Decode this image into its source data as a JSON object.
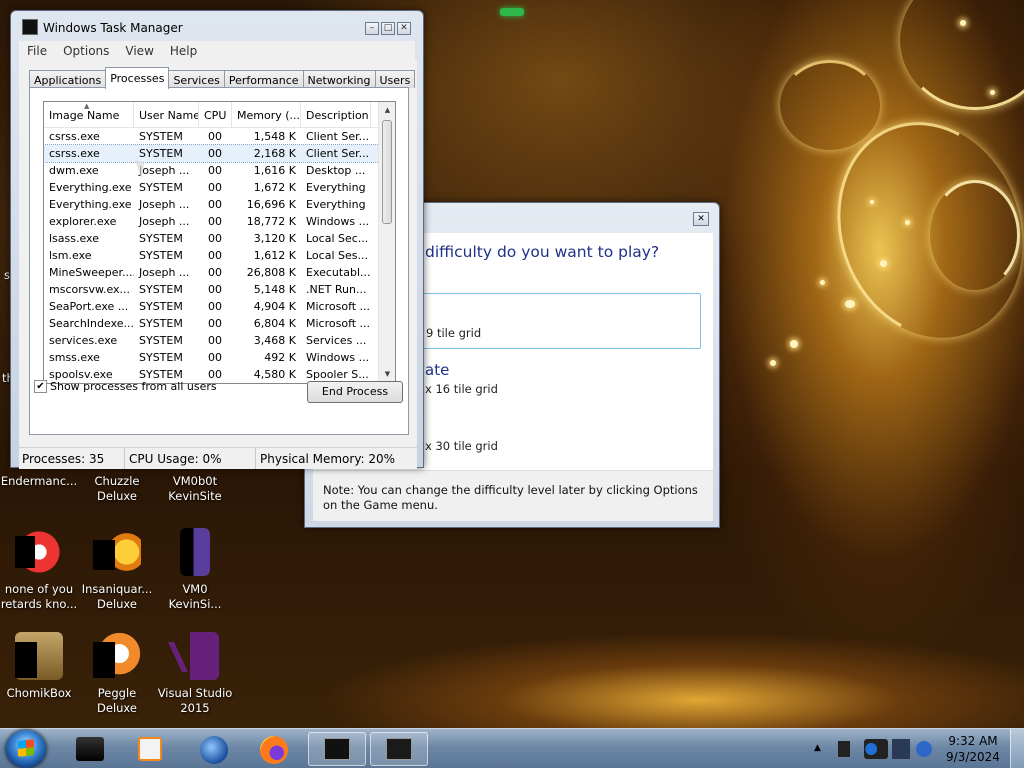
{
  "task_manager": {
    "title": "Windows Task Manager",
    "menu": [
      "File",
      "Options",
      "View",
      "Help"
    ],
    "tabs": [
      "Applications",
      "Processes",
      "Services",
      "Performance",
      "Networking",
      "Users"
    ],
    "active_tab": "Processes",
    "columns": [
      "Image Name",
      "User Name",
      "CPU",
      "Memory (...",
      "Description"
    ],
    "rows": [
      [
        "csrss.exe",
        "SYSTEM",
        "00",
        "1,548 K",
        "Client Ser..."
      ],
      [
        "csrss.exe",
        "SYSTEM",
        "00",
        "2,168 K",
        "Client Ser..."
      ],
      [
        "dwm.exe",
        "Joseph ...",
        "00",
        "1,616 K",
        "Desktop ..."
      ],
      [
        "Everything.exe",
        "SYSTEM",
        "00",
        "1,672 K",
        "Everything"
      ],
      [
        "Everything.exe",
        "Joseph ...",
        "00",
        "16,696 K",
        "Everything"
      ],
      [
        "explorer.exe",
        "Joseph ...",
        "00",
        "18,772 K",
        "Windows ..."
      ],
      [
        "lsass.exe",
        "SYSTEM",
        "00",
        "3,120 K",
        "Local Sec..."
      ],
      [
        "lsm.exe",
        "SYSTEM",
        "00",
        "1,612 K",
        "Local Ses..."
      ],
      [
        "MineSweeper....",
        "Joseph ...",
        "00",
        "26,808 K",
        "Executabl..."
      ],
      [
        "mscorsvw.ex...",
        "SYSTEM",
        "00",
        "5,148 K",
        ".NET Run..."
      ],
      [
        "SeaPort.exe ...",
        "SYSTEM",
        "00",
        "4,904 K",
        "Microsoft ..."
      ],
      [
        "SearchIndexe...",
        "SYSTEM",
        "00",
        "6,804 K",
        "Microsoft ..."
      ],
      [
        "services.exe",
        "SYSTEM",
        "00",
        "3,468 K",
        "Services ..."
      ],
      [
        "smss.exe",
        "SYSTEM",
        "00",
        "492 K",
        "Windows ..."
      ],
      [
        "spoolsv.exe",
        "SYSTEM",
        "00",
        "4,580 K",
        "Spooler S..."
      ]
    ],
    "selected_row": 1,
    "show_all_label": "Show processes from all users",
    "show_all_checked": true,
    "end_process_label": "End Process",
    "status": {
      "processes": "Processes: 35",
      "cpu": "CPU Usage: 0%",
      "memory": "Physical Memory: 20%"
    }
  },
  "difficulty_dialog": {
    "question": "difficulty do you want to play?",
    "options": [
      {
        "head": "",
        "sub": "9 tile grid"
      },
      {
        "head": "ate",
        "sub": "x 16 tile grid"
      },
      {
        "head": "",
        "sub": "x 30 tile grid"
      }
    ],
    "note": "Note: You can change the difficulty level later by clicking Options on the Game menu."
  },
  "desktop_icons": [
    {
      "label": "Endermanc...",
      "icon": "app-icon"
    },
    {
      "label": "Chuzzle Deluxe",
      "icon": "chuzzle-icon"
    },
    {
      "label": "VM0b0t KevinSite",
      "icon": "vm-file-icon"
    },
    {
      "label": "none of you retards kno...",
      "icon": "chrome-icon"
    },
    {
      "label": "Insaniquar... Deluxe",
      "icon": "insaniquarium-icon"
    },
    {
      "label": "VM0 KevinSi...",
      "icon": "vm-file-icon"
    },
    {
      "label": "ChomikBox",
      "icon": "chomikbox-icon"
    },
    {
      "label": "Peggle Deluxe",
      "icon": "peggle-icon"
    },
    {
      "label": "Visual Studio 2015",
      "icon": "visual-studio-icon"
    }
  ],
  "edge_labels": {
    "left1": "s",
    "left2": "th"
  },
  "taskbar": {
    "items": [
      "start-button",
      "terminal-icon",
      "media-player-icon",
      "browser-globe-icon",
      "firefox-icon",
      "task-manager-icon",
      "minesweeper-icon"
    ],
    "time": "9:32 AM",
    "date": "9/3/2024"
  }
}
